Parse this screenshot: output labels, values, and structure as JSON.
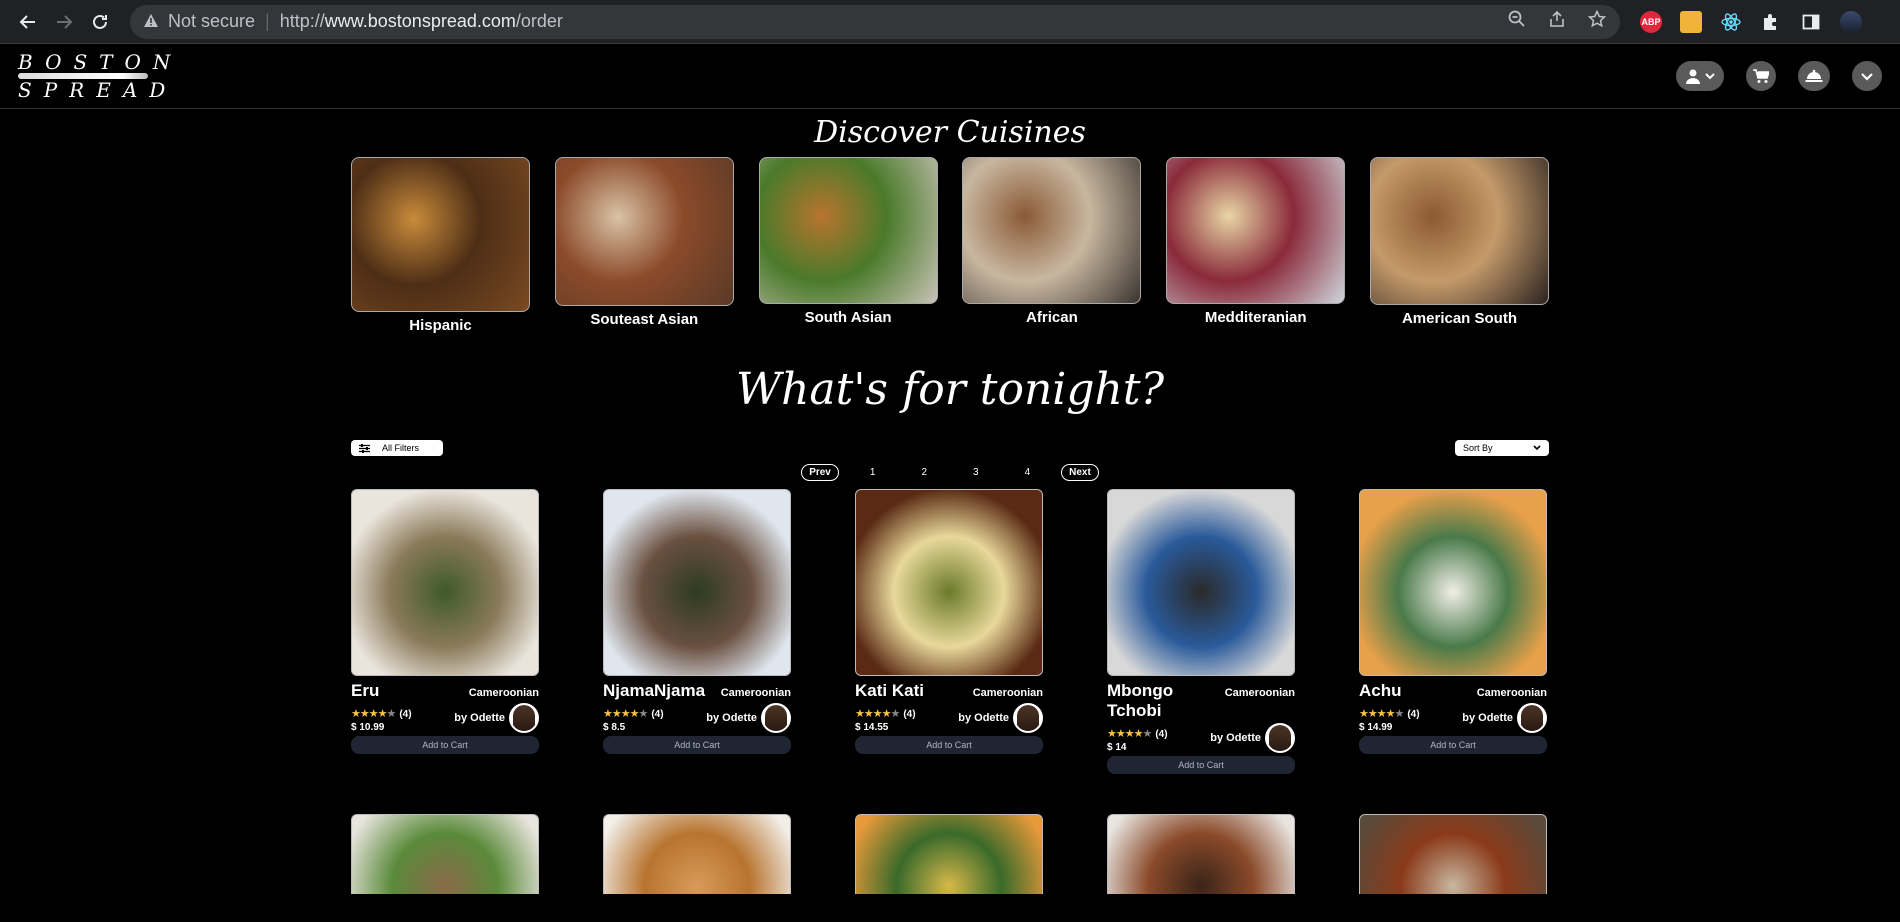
{
  "browser": {
    "security_label": "Not secure",
    "url_prefix": "http://",
    "url_host": "www.bostonspread.com",
    "url_path": "/order",
    "ext_abp": "ABP"
  },
  "site": {
    "logo_line1": "BOSTON",
    "logo_line2": "SPREAD"
  },
  "discover": {
    "title": "Discover Cuisines",
    "cuisines": [
      {
        "label": "Hispanic",
        "colors": [
          "#7a4a22",
          "#c98b3b",
          "#4d2e16"
        ]
      },
      {
        "label": "Souteast Asian",
        "colors": [
          "#5a3a26",
          "#d9c3a5",
          "#8b4a2a"
        ]
      },
      {
        "label": "South Asian",
        "colors": [
          "#c9c3b7",
          "#b8742e",
          "#4a7a2a"
        ]
      },
      {
        "label": "African",
        "colors": [
          "#3a3430",
          "#8a5a36",
          "#c8b7a0"
        ]
      },
      {
        "label": "Medditeranian",
        "colors": [
          "#cfd6dc",
          "#e8d6a5",
          "#8a2a3a"
        ]
      },
      {
        "label": "American South",
        "colors": [
          "#2b2320",
          "#8a5a30",
          "#c59a6a"
        ]
      }
    ]
  },
  "tonight": {
    "title": "What's for tonight?",
    "filters_label": "All Filters",
    "sort_label": "Sort By",
    "pager": {
      "prev": "Prev",
      "pages": [
        "1",
        "2",
        "3",
        "4"
      ],
      "next": "Next"
    }
  },
  "dishes": [
    {
      "name": "Eru",
      "origin": "Cameroonian",
      "rating": 4,
      "reviews": "(4)",
      "price": "$ 10.99",
      "by": "by Odette",
      "add": "Add to Cart",
      "colors": [
        "#e9e4dc",
        "#3f5a2a",
        "#8a7a5a"
      ]
    },
    {
      "name": "NjamaNjama",
      "origin": "Cameroonian",
      "rating": 4,
      "reviews": "(4)",
      "price": "$ 8.5",
      "by": "by Odette",
      "add": "Add to Cart",
      "colors": [
        "#dfe6ee",
        "#2d3b22",
        "#6a5040"
      ]
    },
    {
      "name": "Kati Kati",
      "origin": "Cameroonian",
      "rating": 4,
      "reviews": "(4)",
      "price": "$ 14.55",
      "by": "by Odette",
      "add": "Add to Cart",
      "colors": [
        "#5a2a14",
        "#6a7a2a",
        "#e8d89a"
      ]
    },
    {
      "name": "Mbongo Tchobi",
      "origin": "Cameroonian",
      "rating": 4,
      "reviews": "(4)",
      "price": "$ 14",
      "by": "by Odette",
      "add": "Add to Cart",
      "colors": [
        "#d8d8d8",
        "#2a2a2a",
        "#2a5a9a"
      ]
    },
    {
      "name": "Achu",
      "origin": "Cameroonian",
      "rating": 4,
      "reviews": "(4)",
      "price": "$ 14.99",
      "by": "by Odette",
      "add": "Add to Cart",
      "colors": [
        "#e8a04a",
        "#f2efe8",
        "#4a7a4a"
      ]
    }
  ],
  "dishes_row2_colors": [
    [
      "#e8e4de",
      "#8a6a4a",
      "#5a8a3a"
    ],
    [
      "#f2eee8",
      "#d89a5a",
      "#b8742e"
    ],
    [
      "#e89a3a",
      "#d8b84a",
      "#3a6a2a"
    ],
    [
      "#e8e4e0",
      "#3a2418",
      "#8a4a2a"
    ],
    [
      "#5a4a3a",
      "#c8b8a0",
      "#8a3a1a"
    ]
  ]
}
